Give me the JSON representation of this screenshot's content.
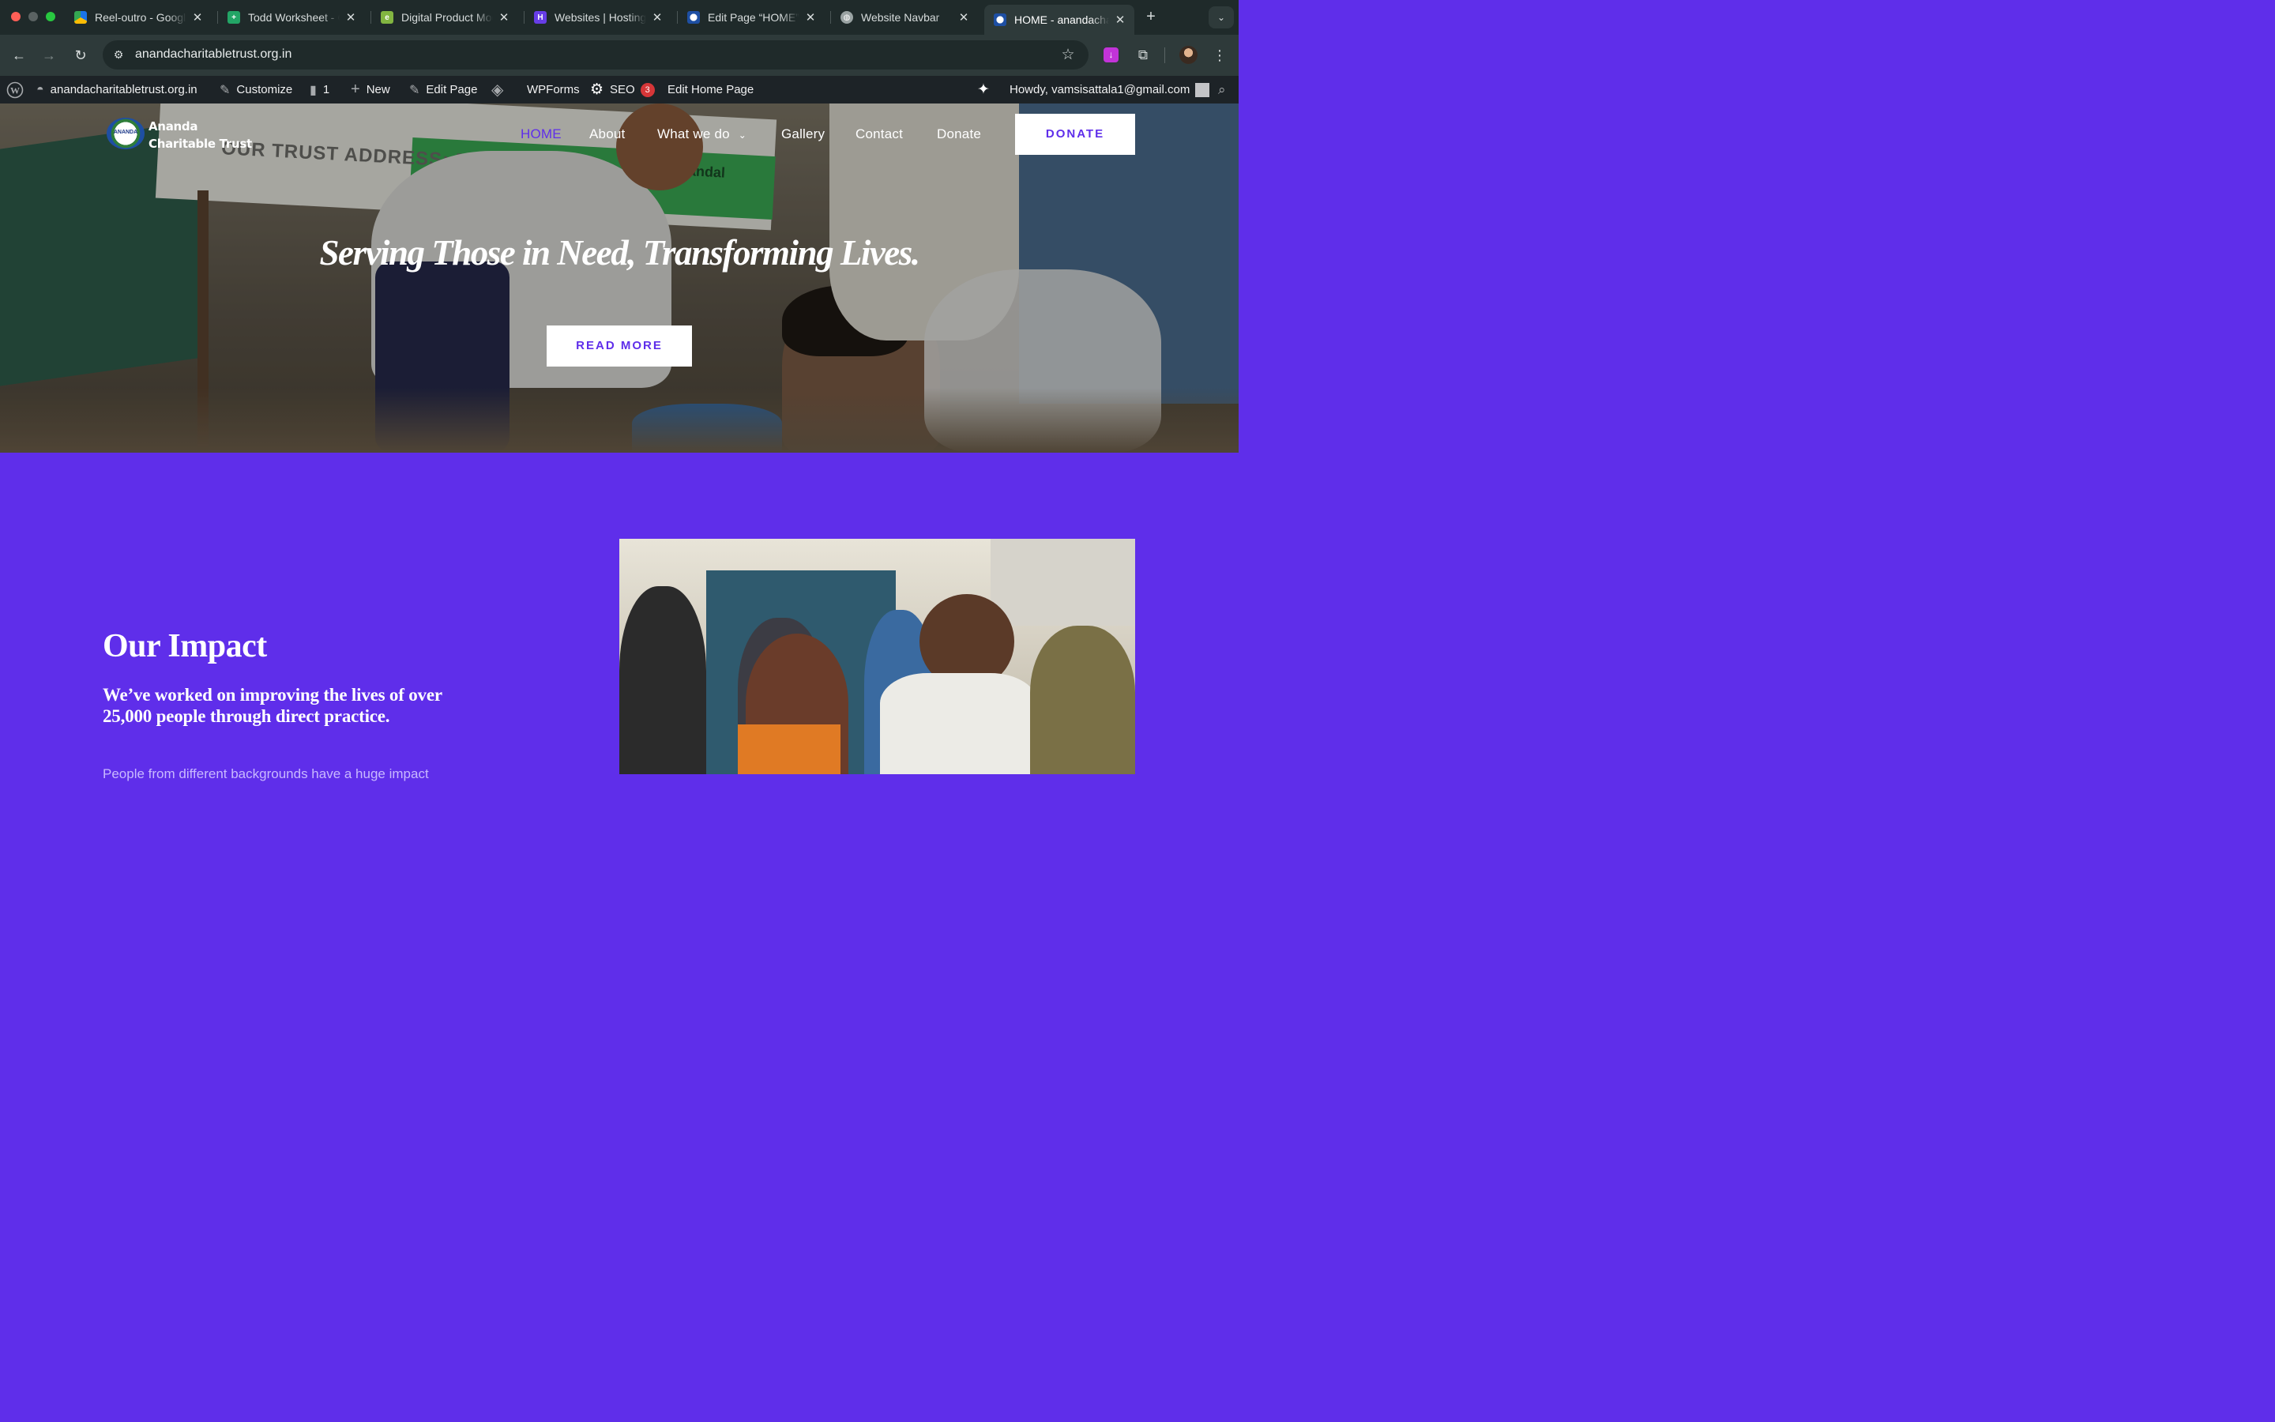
{
  "browser": {
    "tabs": [
      {
        "title": "Reel-outro - Google Drive",
        "icon": "google-drive-icon"
      },
      {
        "title": "Todd Worksheet - Google Sheets",
        "icon": "google-sheets-icon"
      },
      {
        "title": "Digital Product Mockup",
        "icon": "envato-icon"
      },
      {
        "title": "Websites | Hostinger",
        "icon": "hostinger-icon"
      },
      {
        "title": "Edit Page “HOME”",
        "icon": "site-favicon"
      },
      {
        "title": "Website Navbar",
        "icon": "globe-icon"
      },
      {
        "title": "HOME - anandacharitabletrust",
        "icon": "site-favicon",
        "active": true
      }
    ],
    "url": "anandacharitabletrust.org.in"
  },
  "admin_bar": {
    "site": "anandacharitabletrust.org.in",
    "customize": "Customize",
    "comments": "1",
    "new": "New",
    "edit_page": "Edit Page",
    "wpforms": "WPForms",
    "seo": "SEO",
    "seo_count": "3",
    "edit_home": "Edit Home Page",
    "howdy": "Howdy, vamsisattala1@gmail.com"
  },
  "site": {
    "logo_line1": "Ananda",
    "logo_line2": "Charitable Trust",
    "logo_badge": "ANANDA",
    "nav": {
      "home": "HOME",
      "about": "About",
      "what_we_do": "What we do",
      "gallery": "Gallery",
      "contact": "Contact",
      "donate": "Donate"
    },
    "donate_button": "DONATE",
    "hero_title": "Serving Those in Need, Transforming Lives.",
    "hero_button": "READ MORE",
    "banner_text": "OUR TRUST ADDRESS: D.N",
    "banner_text2": "Mandal",
    "impact_title": "Our Impact",
    "impact_subtitle": "We’ve worked on improving the lives of over 25,000 people through direct practice.",
    "impact_body": "People from different backgrounds have a huge impact"
  },
  "colors": {
    "brand_purple": "#5f2eea",
    "chrome_dark": "#1f2a2a",
    "admin_bar": "#1d2327"
  }
}
